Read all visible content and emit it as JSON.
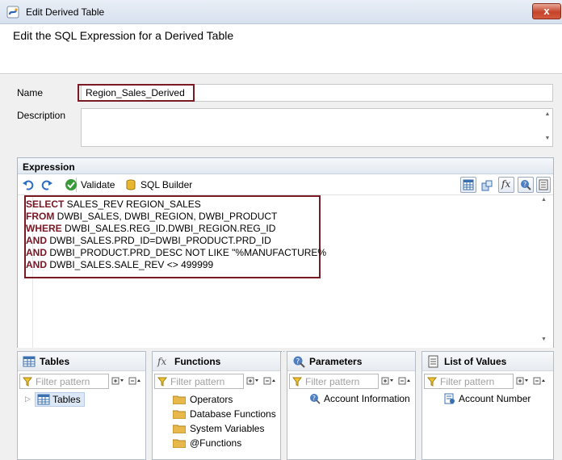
{
  "window": {
    "title": "Edit Derived Table",
    "close_glyph": "x"
  },
  "header": {
    "title": "Edit the SQL Expression for a Derived Table"
  },
  "form": {
    "name_label": "Name",
    "name_value": "Region_Sales_Derived",
    "description_label": "Description",
    "description_value": ""
  },
  "expression": {
    "title": "Expression",
    "toolbar": {
      "undo_icon": "undo-icon",
      "redo_icon": "redo-icon",
      "validate_label": "Validate",
      "sql_builder_label": "SQL Builder"
    },
    "sql": [
      {
        "kw": "SELECT",
        "rest": " SALES_REV REGION_SALES"
      },
      {
        "kw": "FROM",
        "rest": " DWBI_SALES, DWBI_REGION, DWBI_PRODUCT"
      },
      {
        "kw": "WHERE",
        "rest": " DWBI_SALES.REG_ID.DWBI_REGION.REG_ID"
      },
      {
        "kw": "AND",
        "rest": " DWBI_SALES.PRD_ID=DWBI_PRODUCT.PRD_ID"
      },
      {
        "kw": "AND",
        "rest": " DWBI_PRODUCT.PRD_DESC NOT LIKE \"%MANUFACTURE%"
      },
      {
        "kw": "AND",
        "rest": " DWBI_SALES.SALE_REV <> 499999"
      }
    ]
  },
  "splitter": ".....",
  "panels": {
    "tables": {
      "title": "Tables",
      "filter_placeholder": "Filter pattern",
      "items": [
        "Tables"
      ]
    },
    "functions": {
      "title": "Functions",
      "filter_placeholder": "Filter pattern",
      "items": [
        "Operators",
        "Database Functions",
        "System Variables",
        "@Functions"
      ]
    },
    "parameters": {
      "title": "Parameters",
      "filter_placeholder": "Filter pattern",
      "items": [
        "Account Information"
      ]
    },
    "lov": {
      "title": "List of Values",
      "filter_placeholder": "Filter pattern",
      "items": [
        "Account Number"
      ]
    }
  },
  "colors": {
    "highlight_border": "#7a1a24",
    "keyword": "#7a1624",
    "panel_border": "#b4bcc8",
    "folder": "#e8b84a"
  }
}
